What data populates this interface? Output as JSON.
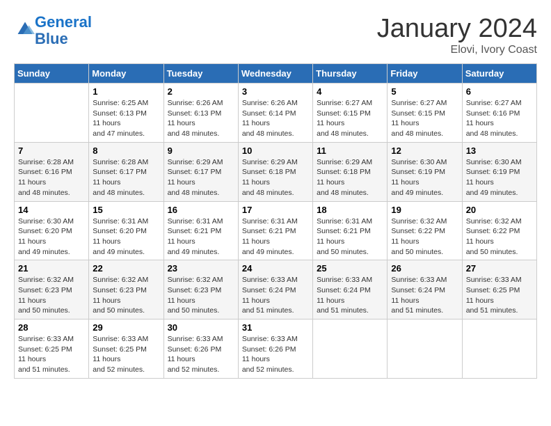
{
  "header": {
    "logo_line1": "General",
    "logo_line2": "Blue",
    "month_title": "January 2024",
    "location": "Elovi, Ivory Coast"
  },
  "weekdays": [
    "Sunday",
    "Monday",
    "Tuesday",
    "Wednesday",
    "Thursday",
    "Friday",
    "Saturday"
  ],
  "weeks": [
    [
      {
        "day": "",
        "sunrise": "",
        "sunset": "",
        "daylight": ""
      },
      {
        "day": "1",
        "sunrise": "Sunrise: 6:25 AM",
        "sunset": "Sunset: 6:13 PM",
        "daylight": "Daylight: 11 hours and 47 minutes."
      },
      {
        "day": "2",
        "sunrise": "Sunrise: 6:26 AM",
        "sunset": "Sunset: 6:13 PM",
        "daylight": "Daylight: 11 hours and 48 minutes."
      },
      {
        "day": "3",
        "sunrise": "Sunrise: 6:26 AM",
        "sunset": "Sunset: 6:14 PM",
        "daylight": "Daylight: 11 hours and 48 minutes."
      },
      {
        "day": "4",
        "sunrise": "Sunrise: 6:27 AM",
        "sunset": "Sunset: 6:15 PM",
        "daylight": "Daylight: 11 hours and 48 minutes."
      },
      {
        "day": "5",
        "sunrise": "Sunrise: 6:27 AM",
        "sunset": "Sunset: 6:15 PM",
        "daylight": "Daylight: 11 hours and 48 minutes."
      },
      {
        "day": "6",
        "sunrise": "Sunrise: 6:27 AM",
        "sunset": "Sunset: 6:16 PM",
        "daylight": "Daylight: 11 hours and 48 minutes."
      }
    ],
    [
      {
        "day": "7",
        "sunrise": "Sunrise: 6:28 AM",
        "sunset": "Sunset: 6:16 PM",
        "daylight": "Daylight: 11 hours and 48 minutes."
      },
      {
        "day": "8",
        "sunrise": "Sunrise: 6:28 AM",
        "sunset": "Sunset: 6:17 PM",
        "daylight": "Daylight: 11 hours and 48 minutes."
      },
      {
        "day": "9",
        "sunrise": "Sunrise: 6:29 AM",
        "sunset": "Sunset: 6:17 PM",
        "daylight": "Daylight: 11 hours and 48 minutes."
      },
      {
        "day": "10",
        "sunrise": "Sunrise: 6:29 AM",
        "sunset": "Sunset: 6:18 PM",
        "daylight": "Daylight: 11 hours and 48 minutes."
      },
      {
        "day": "11",
        "sunrise": "Sunrise: 6:29 AM",
        "sunset": "Sunset: 6:18 PM",
        "daylight": "Daylight: 11 hours and 48 minutes."
      },
      {
        "day": "12",
        "sunrise": "Sunrise: 6:30 AM",
        "sunset": "Sunset: 6:19 PM",
        "daylight": "Daylight: 11 hours and 49 minutes."
      },
      {
        "day": "13",
        "sunrise": "Sunrise: 6:30 AM",
        "sunset": "Sunset: 6:19 PM",
        "daylight": "Daylight: 11 hours and 49 minutes."
      }
    ],
    [
      {
        "day": "14",
        "sunrise": "Sunrise: 6:30 AM",
        "sunset": "Sunset: 6:20 PM",
        "daylight": "Daylight: 11 hours and 49 minutes."
      },
      {
        "day": "15",
        "sunrise": "Sunrise: 6:31 AM",
        "sunset": "Sunset: 6:20 PM",
        "daylight": "Daylight: 11 hours and 49 minutes."
      },
      {
        "day": "16",
        "sunrise": "Sunrise: 6:31 AM",
        "sunset": "Sunset: 6:21 PM",
        "daylight": "Daylight: 11 hours and 49 minutes."
      },
      {
        "day": "17",
        "sunrise": "Sunrise: 6:31 AM",
        "sunset": "Sunset: 6:21 PM",
        "daylight": "Daylight: 11 hours and 49 minutes."
      },
      {
        "day": "18",
        "sunrise": "Sunrise: 6:31 AM",
        "sunset": "Sunset: 6:21 PM",
        "daylight": "Daylight: 11 hours and 50 minutes."
      },
      {
        "day": "19",
        "sunrise": "Sunrise: 6:32 AM",
        "sunset": "Sunset: 6:22 PM",
        "daylight": "Daylight: 11 hours and 50 minutes."
      },
      {
        "day": "20",
        "sunrise": "Sunrise: 6:32 AM",
        "sunset": "Sunset: 6:22 PM",
        "daylight": "Daylight: 11 hours and 50 minutes."
      }
    ],
    [
      {
        "day": "21",
        "sunrise": "Sunrise: 6:32 AM",
        "sunset": "Sunset: 6:23 PM",
        "daylight": "Daylight: 11 hours and 50 minutes."
      },
      {
        "day": "22",
        "sunrise": "Sunrise: 6:32 AM",
        "sunset": "Sunset: 6:23 PM",
        "daylight": "Daylight: 11 hours and 50 minutes."
      },
      {
        "day": "23",
        "sunrise": "Sunrise: 6:32 AM",
        "sunset": "Sunset: 6:23 PM",
        "daylight": "Daylight: 11 hours and 50 minutes."
      },
      {
        "day": "24",
        "sunrise": "Sunrise: 6:33 AM",
        "sunset": "Sunset: 6:24 PM",
        "daylight": "Daylight: 11 hours and 51 minutes."
      },
      {
        "day": "25",
        "sunrise": "Sunrise: 6:33 AM",
        "sunset": "Sunset: 6:24 PM",
        "daylight": "Daylight: 11 hours and 51 minutes."
      },
      {
        "day": "26",
        "sunrise": "Sunrise: 6:33 AM",
        "sunset": "Sunset: 6:24 PM",
        "daylight": "Daylight: 11 hours and 51 minutes."
      },
      {
        "day": "27",
        "sunrise": "Sunrise: 6:33 AM",
        "sunset": "Sunset: 6:25 PM",
        "daylight": "Daylight: 11 hours and 51 minutes."
      }
    ],
    [
      {
        "day": "28",
        "sunrise": "Sunrise: 6:33 AM",
        "sunset": "Sunset: 6:25 PM",
        "daylight": "Daylight: 11 hours and 51 minutes."
      },
      {
        "day": "29",
        "sunrise": "Sunrise: 6:33 AM",
        "sunset": "Sunset: 6:25 PM",
        "daylight": "Daylight: 11 hours and 52 minutes."
      },
      {
        "day": "30",
        "sunrise": "Sunrise: 6:33 AM",
        "sunset": "Sunset: 6:26 PM",
        "daylight": "Daylight: 11 hours and 52 minutes."
      },
      {
        "day": "31",
        "sunrise": "Sunrise: 6:33 AM",
        "sunset": "Sunset: 6:26 PM",
        "daylight": "Daylight: 11 hours and 52 minutes."
      },
      {
        "day": "",
        "sunrise": "",
        "sunset": "",
        "daylight": ""
      },
      {
        "day": "",
        "sunrise": "",
        "sunset": "",
        "daylight": ""
      },
      {
        "day": "",
        "sunrise": "",
        "sunset": "",
        "daylight": ""
      }
    ]
  ]
}
